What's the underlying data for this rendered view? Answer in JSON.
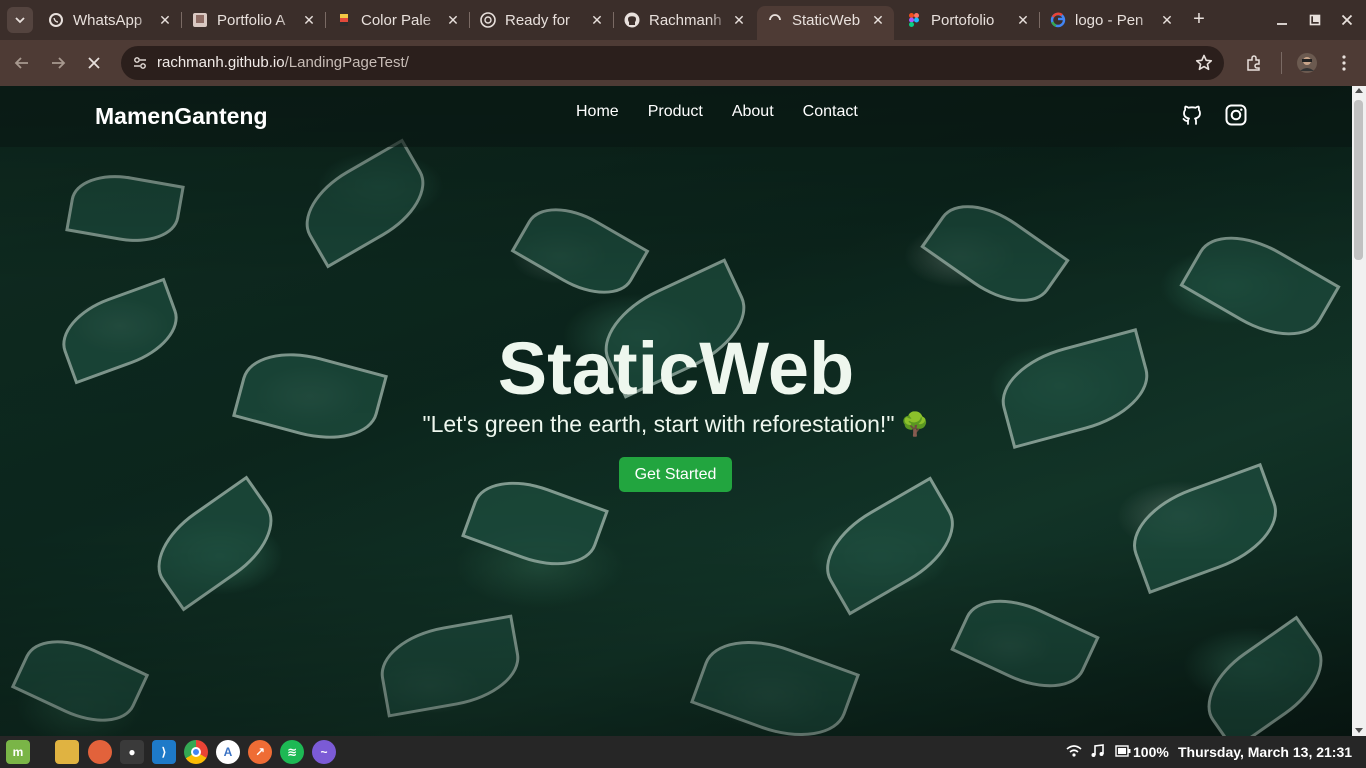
{
  "browser": {
    "tabs": [
      {
        "title": "WhatsApp",
        "favicon": "whatsapp-icon",
        "active": false
      },
      {
        "title": "Portfolio A",
        "favicon": "portfolio-icon",
        "active": false
      },
      {
        "title": "Color Pale",
        "favicon": "color-palette-icon",
        "active": false
      },
      {
        "title": "Ready for",
        "favicon": "openai-icon",
        "active": false
      },
      {
        "title": "Rachmanh",
        "favicon": "github-icon",
        "active": false
      },
      {
        "title": "StaticWeb",
        "favicon": "loading-icon",
        "active": true
      },
      {
        "title": "Portofolio",
        "favicon": "figma-icon",
        "active": false
      },
      {
        "title": "logo - Pen",
        "favicon": "google-icon",
        "active": false
      }
    ],
    "address": {
      "host": "rachmanh.github.io",
      "path": "/LandingPageTest/"
    }
  },
  "site": {
    "brand": "MamenGanteng",
    "nav": [
      "Home",
      "Product",
      "About",
      "Contact"
    ],
    "social": [
      "github-icon",
      "instagram-icon"
    ],
    "hero": {
      "title": "StaticWeb",
      "subtitle": "\"Let's green the earth, start with reforestation!\"",
      "emoji": "🌳",
      "cta": "Get Started"
    }
  },
  "taskbar": {
    "apps": [
      "mint-menu-icon",
      "files-icon",
      "firefox-icon",
      "incognito-icon",
      "vscode-icon",
      "chrome-icon",
      "appimage-icon",
      "postman-icon",
      "spotify-icon",
      "stremio-icon"
    ],
    "battery": "100%",
    "datetime": "Thursday, March 13, 21:31"
  },
  "colors": {
    "accent": "#22a53f",
    "chrome": "#4e3b35",
    "tabstrip": "#3b2e2a"
  }
}
